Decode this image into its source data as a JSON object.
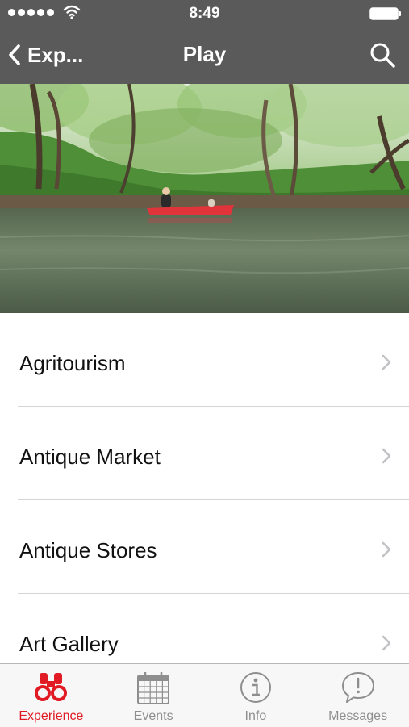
{
  "status_bar": {
    "time": "8:49"
  },
  "nav_bar": {
    "back_label": "Exp...",
    "title": "Play"
  },
  "categories": [
    {
      "label": "Agritourism"
    },
    {
      "label": "Antique Market"
    },
    {
      "label": "Antique Stores"
    },
    {
      "label": "Art Gallery"
    }
  ],
  "tab_bar": {
    "tabs": [
      {
        "label": "Experience",
        "icon": "binoculars-icon",
        "active": true
      },
      {
        "label": "Events",
        "icon": "calendar-icon",
        "active": false
      },
      {
        "label": "Info",
        "icon": "info-icon",
        "active": false
      },
      {
        "label": "Messages",
        "icon": "message-bubble-icon",
        "active": false
      }
    ]
  },
  "colors": {
    "bar": "#5a5a5a",
    "accent": "#e01b24",
    "inactive": "#8e8e8e"
  }
}
